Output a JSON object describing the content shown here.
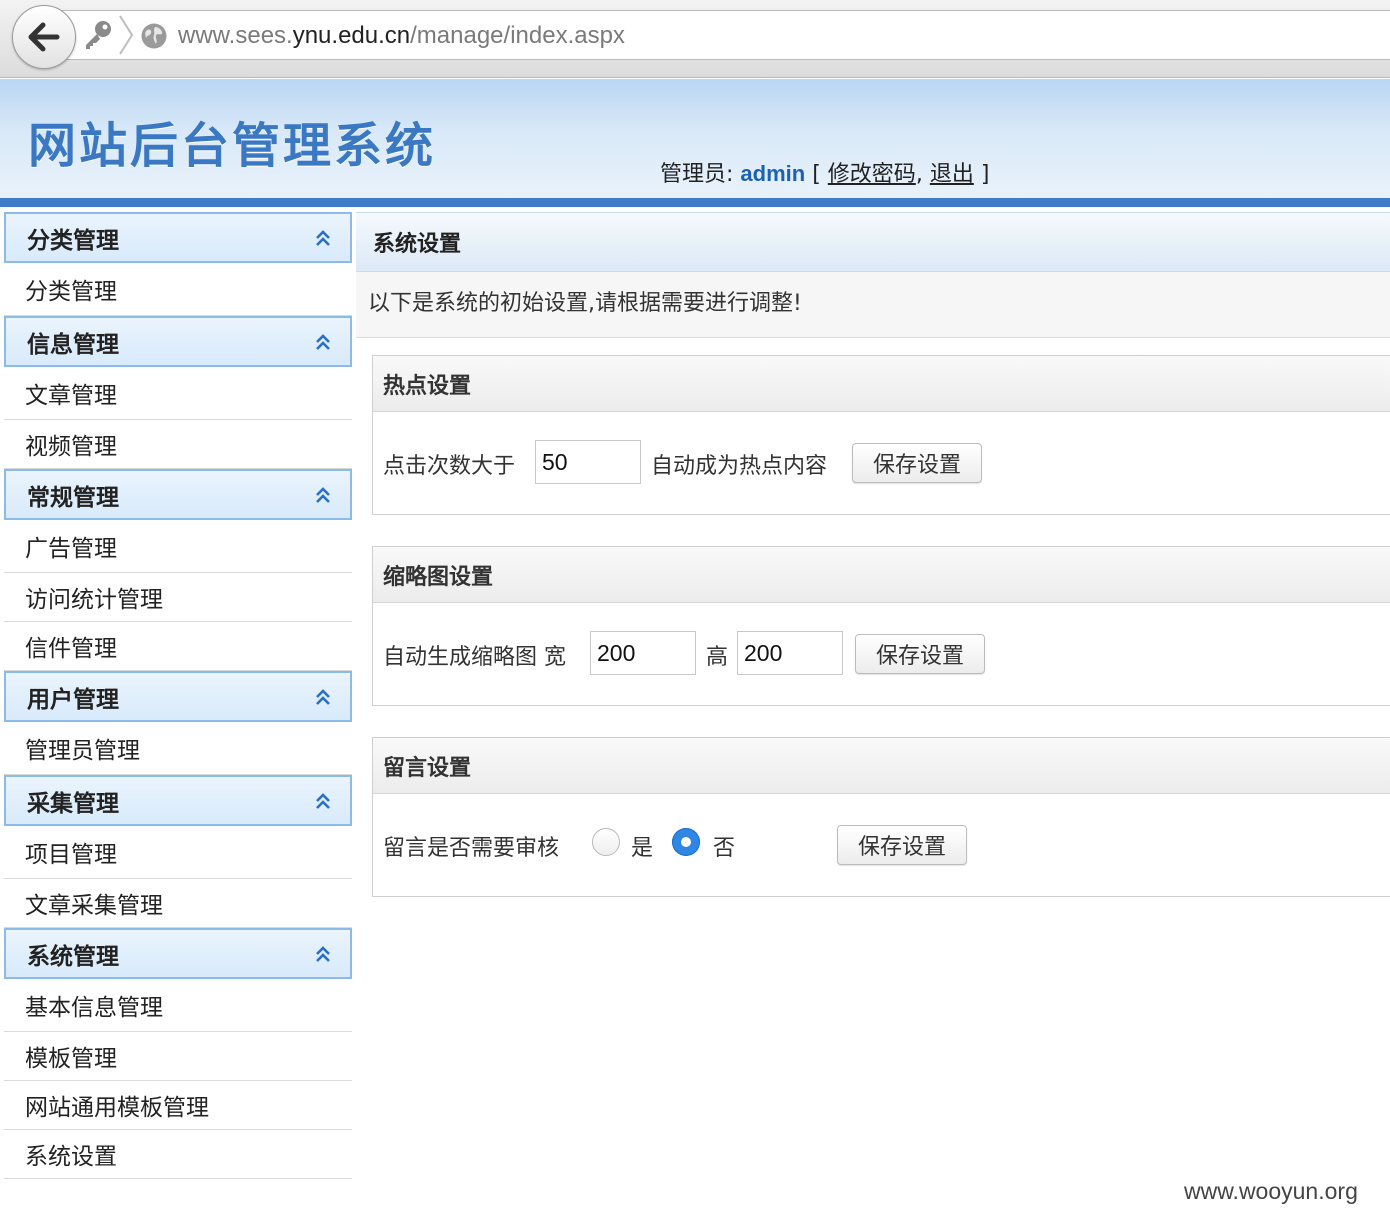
{
  "browser": {
    "url_prefix": "www.sees.",
    "url_domain": "ynu.edu.cn",
    "url_path": "/manage/index.aspx"
  },
  "header": {
    "site_title": "网站后台管理系统",
    "admin_label": "管理员:",
    "admin_name": "admin",
    "bracket_open": " [ ",
    "change_password": "修改密码",
    "separator": ",",
    "logout": "退出",
    "bracket_close": " ]"
  },
  "sidebar": {
    "groups": [
      {
        "title": "分类管理",
        "items": [
          "分类管理"
        ]
      },
      {
        "title": "信息管理",
        "items": [
          "文章管理",
          "视频管理"
        ]
      },
      {
        "title": "常规管理",
        "items": [
          "广告管理",
          "访问统计管理",
          "信件管理"
        ]
      },
      {
        "title": "用户管理",
        "items": [
          "管理员管理"
        ]
      },
      {
        "title": "采集管理",
        "items": [
          "项目管理",
          "文章采集管理"
        ]
      },
      {
        "title": "系统管理",
        "items": [
          "基本信息管理",
          "模板管理",
          "网站通用模板管理",
          "系统设置"
        ]
      }
    ]
  },
  "main": {
    "title": "系统设置",
    "notice": "以下是系统的初始设置,请根据需要进行调整!",
    "hot": {
      "title": "热点设置",
      "label_before": "点击次数大于",
      "value": "50",
      "label_after": "自动成为热点内容",
      "save": "保存设置"
    },
    "thumb": {
      "title": "缩略图设置",
      "label": "自动生成缩略图 宽",
      "width_value": "200",
      "height_label": "高",
      "height_value": "200",
      "save": "保存设置"
    },
    "message": {
      "title": "留言设置",
      "label": "留言是否需要审核",
      "option_yes": "是",
      "option_no": "否",
      "selected": "否",
      "save": "保存设置"
    }
  },
  "watermark": "www.wooyun.org",
  "colors": {
    "header_accent": "#3d7cc9",
    "title_blue": "#3a78c3",
    "admin_blue": "#1a62b8",
    "radio_blue": "#2f86e4"
  }
}
